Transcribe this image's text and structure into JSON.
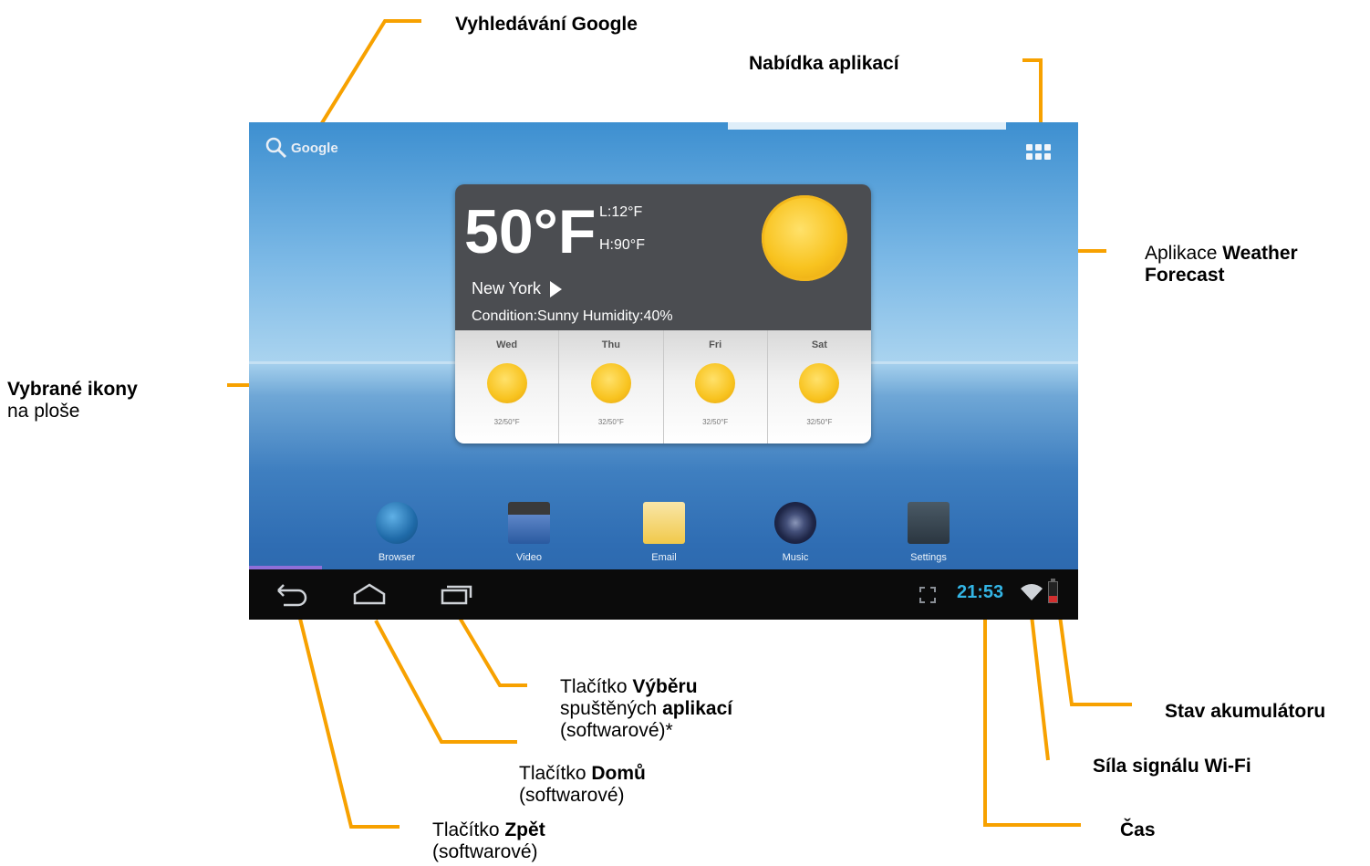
{
  "callouts": {
    "google_search": "Vyhledávání Google",
    "apps_menu": "Nabídka aplikací",
    "weather_prefix": "Aplikace ",
    "weather_bold_1": "Weather",
    "weather_bold_2": "Forecast",
    "icons_bold": "Vybrané ikony",
    "icons_rest": "na ploše",
    "recent_line1_prefix": "Tlačítko ",
    "recent_line1_bold": "Výběru",
    "recent_line2_prefix": "spuštěných ",
    "recent_line2_bold": "aplikací",
    "recent_line3": "(softwarové)*",
    "home_prefix": "Tlačítko ",
    "home_bold": "Domů",
    "home_line2": "(softwarové)",
    "back_prefix": "Tlačítko ",
    "back_bold": "Zpět",
    "back_line2": "(softwarové)",
    "battery": "Stav akumulátoru",
    "wifi": "Síla signálu Wi-Fi",
    "time": "Čas"
  },
  "screen": {
    "search_label": "Google",
    "weather": {
      "temp": "50°F",
      "low": "L:12°F",
      "high": "H:90°F",
      "city": "New York",
      "condition": "Condition:Sunny Humidity:40%",
      "forecast": [
        {
          "day": "Wed",
          "range": "32/50°F"
        },
        {
          "day": "Thu",
          "range": "32/50°F"
        },
        {
          "day": "Fri",
          "range": "32/50°F"
        },
        {
          "day": "Sat",
          "range": "32/50°F"
        }
      ]
    },
    "dock": [
      {
        "label": "Browser",
        "icon": "browser-icon"
      },
      {
        "label": "Video",
        "icon": "video-icon"
      },
      {
        "label": "Email",
        "icon": "email-icon"
      },
      {
        "label": "Music",
        "icon": "music-icon"
      },
      {
        "label": "Settings",
        "icon": "settings-icon"
      }
    ],
    "status": {
      "time": "21:53"
    }
  },
  "colors": {
    "callout_line": "#f7a100",
    "clock": "#33b5e5"
  }
}
